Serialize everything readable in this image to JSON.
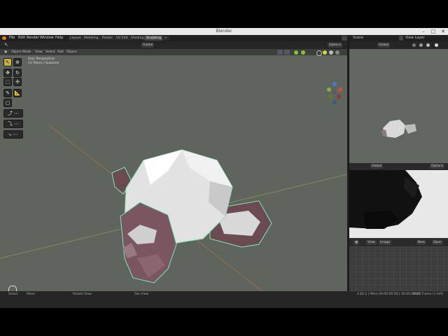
{
  "window": {
    "title": "Blender"
  },
  "menus": [
    "File",
    "Edit",
    "Render",
    "Window",
    "Help"
  ],
  "workspaces": [
    "Layout",
    "Modeling",
    "Rotate",
    "UV Edit",
    "Shading",
    "Sculpting"
  ],
  "workspace_add": "+",
  "scene": {
    "label": "Scene",
    "view_layer": "View Layer"
  },
  "viewport": {
    "mode": "Object Mode",
    "menus": [
      "View",
      "Select",
      "Add",
      "Object"
    ],
    "transform_orientation": "Global",
    "options_label": "Options",
    "info_line1": "User Perspective",
    "info_line2": "(1) Pelvis | Suzanne"
  },
  "right_top": {
    "transform_orientation": "Global",
    "options_label": "Options"
  },
  "right_mid": {
    "transform_orientation": "Global",
    "options_label": "Options"
  },
  "right_bottom": {
    "menus": [
      "View",
      "Image"
    ],
    "new_label": "New",
    "open_label": "Open"
  },
  "status": {
    "left": [
      "Select",
      "Move",
      "Rotate View",
      "Pan View"
    ],
    "right": "2.83.2 | Mem 00:00:00:00 | 00:00:00:00",
    "far_right": "Start Frame (1 left)"
  },
  "colors": {
    "accent": "#c5b23e",
    "viewport_bg": "#5f655d",
    "selection_outline": "#7fe8b8"
  }
}
